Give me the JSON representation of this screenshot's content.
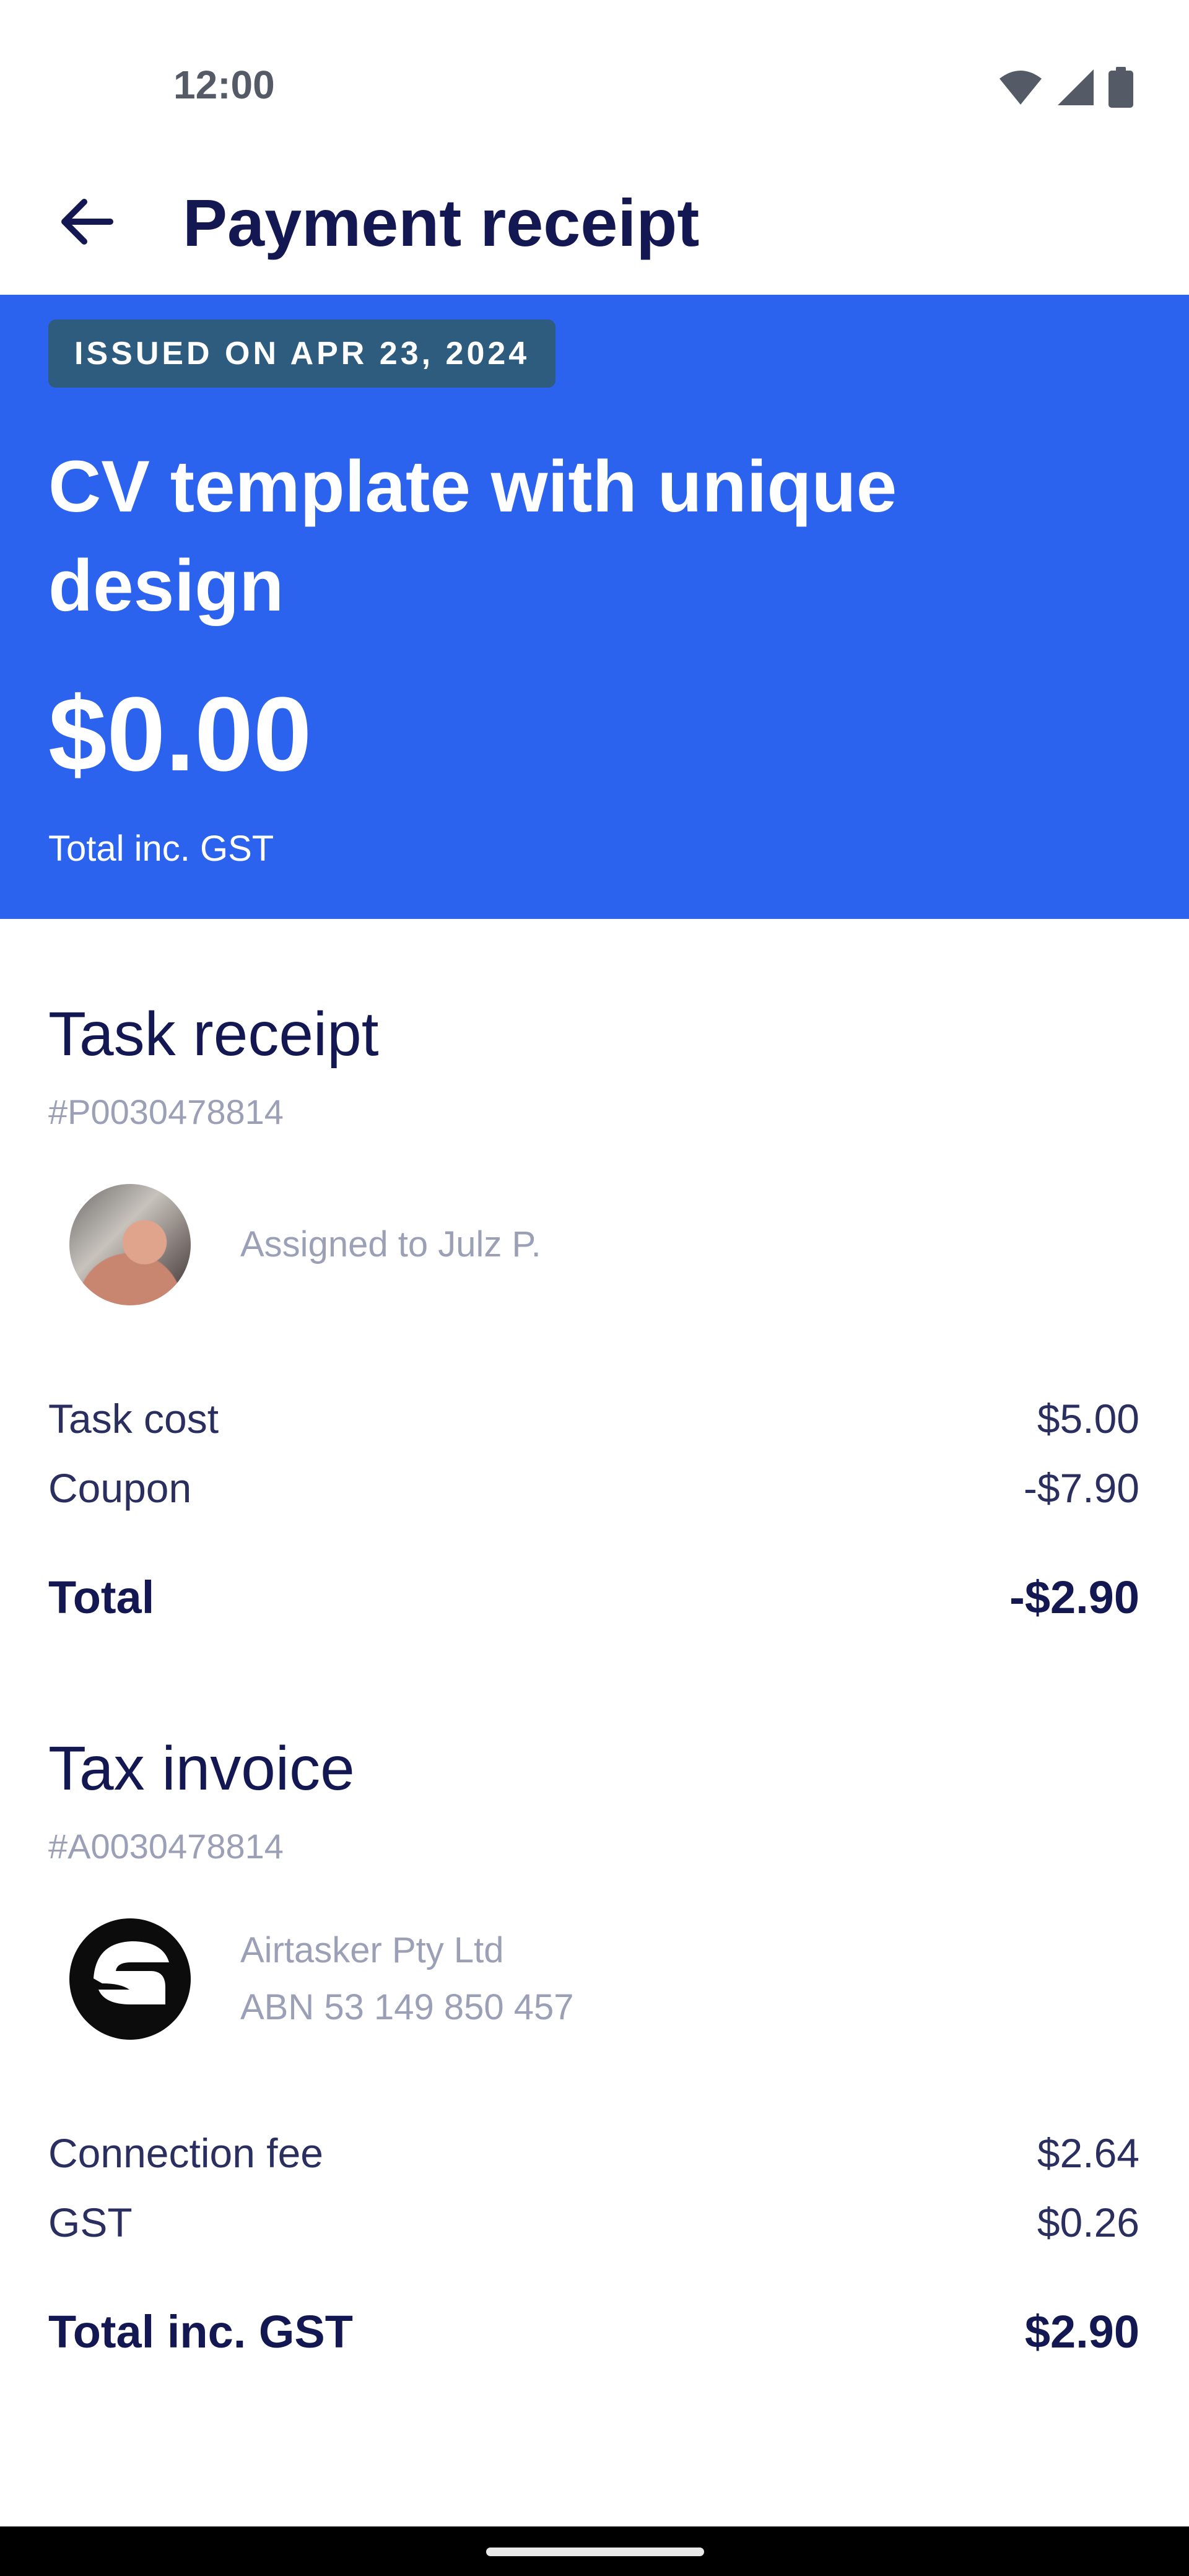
{
  "status_bar": {
    "time": "12:00",
    "icons": [
      "wifi-icon",
      "signal-icon",
      "battery-icon"
    ]
  },
  "header": {
    "back_icon": "arrow-left-icon",
    "title": "Payment receipt"
  },
  "hero": {
    "badge": "ISSUED ON APR 23, 2024",
    "title": "CV template with unique design",
    "amount": "$0.00",
    "amount_label": "Total inc. GST",
    "background_color": "#2c63ee",
    "badge_color": "#2e5c7e"
  },
  "task_receipt": {
    "title": "Task receipt",
    "id": "#P0030478814",
    "assignee": "Assigned to Julz P.",
    "lines": [
      {
        "label": "Task cost",
        "value": "$5.00"
      },
      {
        "label": "Coupon",
        "value": "-$7.90"
      }
    ],
    "total": {
      "label": "Total",
      "value": "-$2.90"
    }
  },
  "tax_invoice": {
    "title": "Tax invoice",
    "id": "#A0030478814",
    "company_name": "Airtasker Pty Ltd",
    "company_abn": "ABN 53 149 850 457",
    "lines": [
      {
        "label": "Connection fee",
        "value": "$2.64"
      },
      {
        "label": "GST",
        "value": "$0.26"
      }
    ],
    "total": {
      "label": "Total inc. GST",
      "value": "$2.90"
    }
  }
}
